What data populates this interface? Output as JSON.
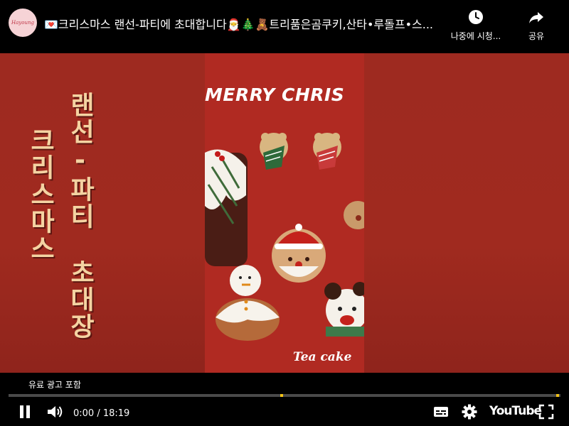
{
  "channel": {
    "avatar_text": "Hayoung"
  },
  "video": {
    "title": "💌크리스마스 랜선-파티에 초대합니다🎅🎄🧸트리품은곰쿠키,산타•루돌프•스...",
    "overlay": {
      "col1": "크리스마스",
      "col2": "랜선-파티",
      "col3": "초대장",
      "merry": "MERRY CHRIS",
      "tea": "Tea cake"
    }
  },
  "top_actions": {
    "watch_later": {
      "label": "나중에 시청...",
      "icon": "clock-icon"
    },
    "share": {
      "label": "공유",
      "icon": "share-arrow-icon"
    }
  },
  "controls": {
    "ad_note": "유료 광고 포함",
    "time": "0:00 / 18:19",
    "progress_fraction": 0,
    "ad_markers": [
      0.497,
      0.997
    ],
    "logo": "YouTube"
  },
  "colors": {
    "background": "#a02a1f",
    "overlay_text": "#f4d3a2",
    "ad_marker": "#f3c316"
  }
}
